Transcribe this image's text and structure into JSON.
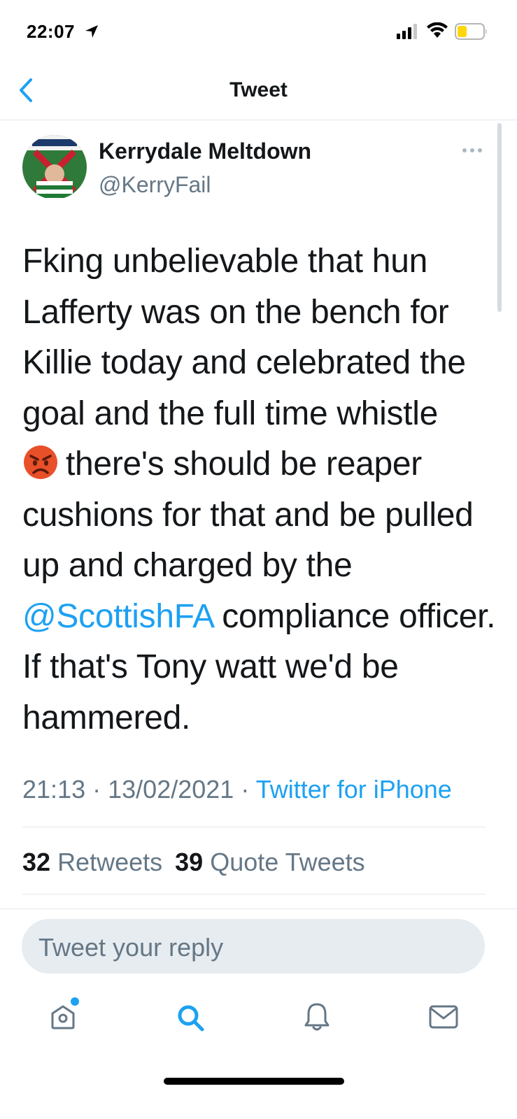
{
  "status_bar": {
    "time": "22:07"
  },
  "header": {
    "title": "Tweet"
  },
  "tweet": {
    "display_name": "Kerrydale Meltdown",
    "handle": "@KerryFail",
    "text_part1": "Fking unbelievable that hun Lafferty was on the bench for Killie today and celebrated the goal and the full time whistle",
    "emoji": "angry-face",
    "text_part2": "there's should be reaper cushions for that and be pulled up and charged by the",
    "mention": "@ScottishFA",
    "text_part3": "compliance officer. If that's Tony watt we'd be hammered.",
    "time": "21:13",
    "date": "13/02/2021",
    "source": "Twitter for iPhone",
    "separator": "·",
    "retweets_count": "32",
    "retweets_label": "Retweets",
    "quotes_count": "39",
    "quotes_label": "Quote Tweets"
  },
  "reply": {
    "placeholder": "Tweet your reply"
  },
  "tab_bar": {
    "items": [
      "home-icon",
      "search-icon",
      "notifications-icon",
      "messages-icon"
    ],
    "accent_color": "#1da1f2"
  },
  "colors": {
    "text": "#14171a",
    "secondary": "#657786",
    "link": "#1da1f2",
    "divider": "#e1e8ed"
  }
}
